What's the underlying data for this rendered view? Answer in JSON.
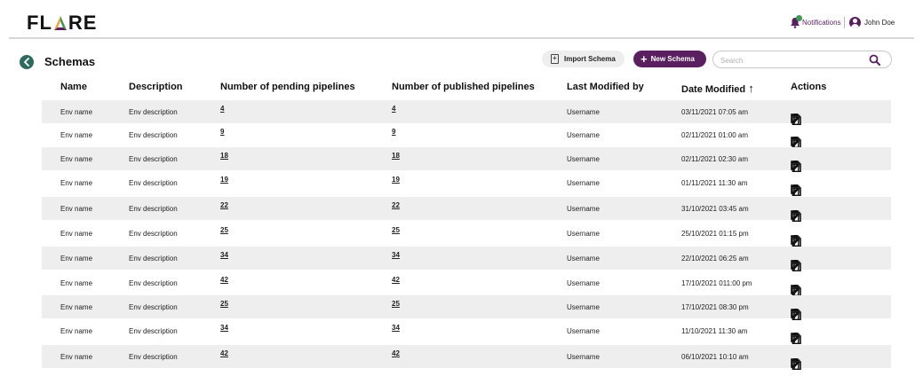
{
  "header": {
    "logo": "FLARE",
    "notifications_label": "Notifications",
    "user_name": "John Doe"
  },
  "page": {
    "title": "Schemas",
    "import_label": "Import Schema",
    "new_label": "New Schema",
    "search_placeholder": "Search"
  },
  "colors": {
    "primary": "#5a1f5f",
    "back_button": "#2e6b5e",
    "row_alt": "#eeeeee",
    "notification_dot": "#3d9a55"
  },
  "table": {
    "columns": {
      "name": "Name",
      "description": "Description",
      "pending": "Number of pending pipelines",
      "published": "Number of published pipelines",
      "modified_by": "Last Modified by",
      "date": "Date Modified",
      "actions": "Actions"
    },
    "sort_indicator": "↑",
    "action_icons": [
      "copy-icon",
      "edit-icon",
      "delete-icon"
    ],
    "rows": [
      {
        "name": "Env name",
        "description": "Env description",
        "pending": "4",
        "published": "4",
        "modified_by": "Username",
        "date": "03/11/2021  07:05 am"
      },
      {
        "name": "Env name",
        "description": "Env description",
        "pending": "9",
        "published": "9",
        "modified_by": "Username",
        "date": "02/11/2021  01:00 am"
      },
      {
        "name": "Env name",
        "description": "Env description",
        "pending": "18",
        "published": "18",
        "modified_by": "Username",
        "date": "02/11/2021  02:30 am"
      },
      {
        "name": "Env name",
        "description": "Env description",
        "pending": "19",
        "published": "19",
        "modified_by": "Username",
        "date": "01/11/2021  11:30 am"
      },
      {
        "name": "Env name",
        "description": "Env description",
        "pending": "22",
        "published": "22",
        "modified_by": "Username",
        "date": "31/10/2021  03:45 am"
      },
      {
        "name": "Env name",
        "description": "Env description",
        "pending": "25",
        "published": "25",
        "modified_by": "Username",
        "date": "25/10/2021  01:15 pm"
      },
      {
        "name": "Env name",
        "description": "Env description",
        "pending": "34",
        "published": "34",
        "modified_by": "Username",
        "date": "22/10/2021  06:25 am"
      },
      {
        "name": "Env name",
        "description": "Env description",
        "pending": "42",
        "published": "42",
        "modified_by": "Username",
        "date": "17/10/2021  011:00 pm"
      },
      {
        "name": "Env name",
        "description": "Env description",
        "pending": "25",
        "published": "25",
        "modified_by": "Username",
        "date": "17/10/2021  08:30 pm"
      },
      {
        "name": "Env name",
        "description": "Env description",
        "pending": "34",
        "published": "34",
        "modified_by": "Username",
        "date": "11/10/2021  11:30 am"
      },
      {
        "name": "Env name",
        "description": "Env description",
        "pending": "42",
        "published": "42",
        "modified_by": "Username",
        "date": "06/10/2021  10:10 am"
      }
    ]
  }
}
